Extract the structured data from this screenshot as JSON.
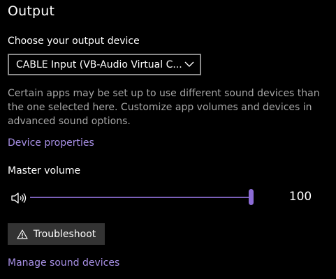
{
  "section": {
    "title": "Output"
  },
  "output_device": {
    "label": "Choose your output device",
    "selected": "CABLE Input (VB-Audio Virtual Cable)",
    "icon": "chevron-down-icon"
  },
  "description": "Certain apps may be set up to use different sound devices than the one selected here. Customize app volumes and devices in advanced sound options.",
  "links": {
    "device_properties": "Device properties",
    "manage_sound_devices": "Manage sound devices"
  },
  "master_volume": {
    "label": "Master volume",
    "value": "100",
    "level_percent": 100,
    "icon": "speaker-icon"
  },
  "troubleshoot": {
    "label": "Troubleshoot",
    "icon": "warning-icon"
  },
  "colors": {
    "background": "#000000",
    "accent": "#8c6cd6",
    "link": "#a890e6",
    "secondary_text": "#a6a6a6",
    "button_bg": "#333333"
  }
}
